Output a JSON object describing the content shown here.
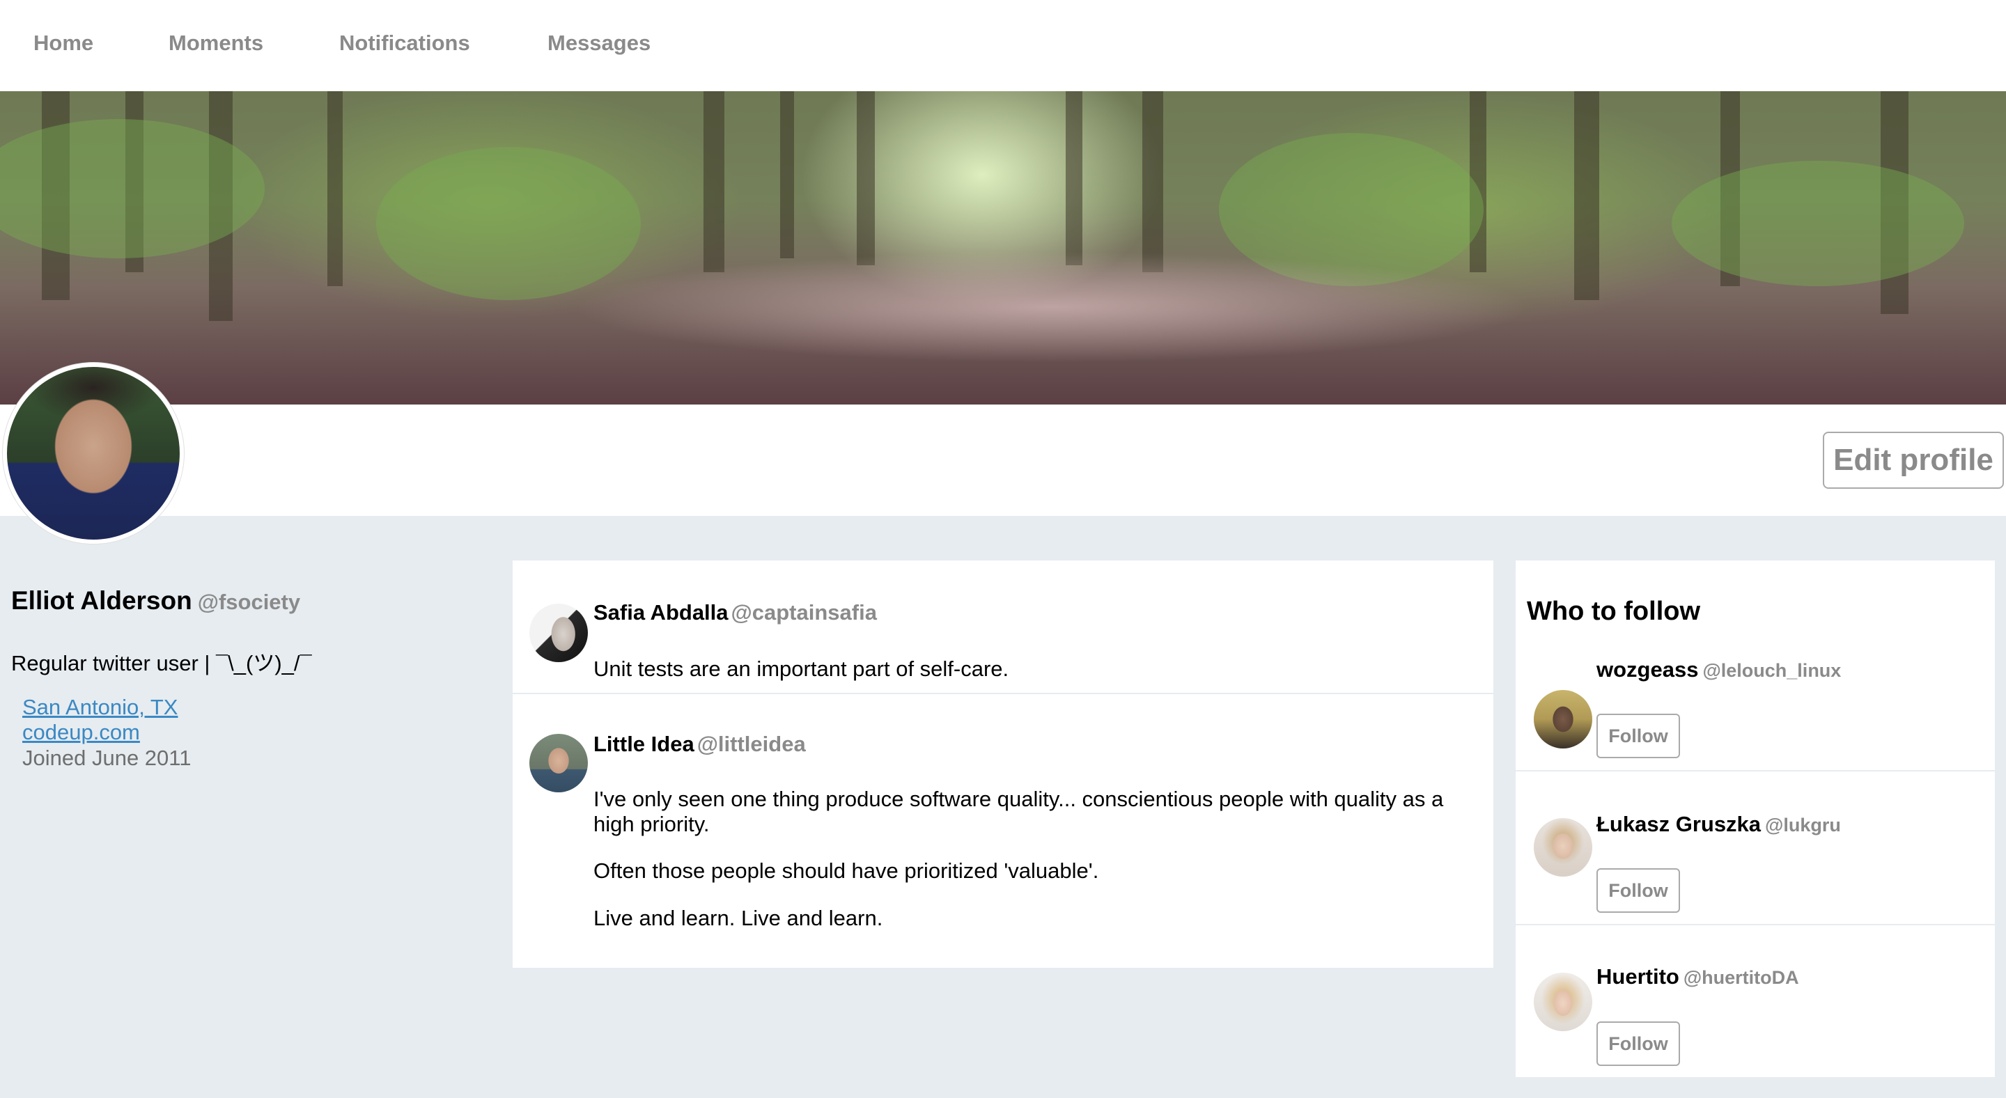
{
  "nav": {
    "items": [
      {
        "label": "Home"
      },
      {
        "label": "Moments"
      },
      {
        "label": "Notifications"
      },
      {
        "label": "Messages"
      }
    ]
  },
  "profile": {
    "name": "Elliot Alderson",
    "handle": "@fsociety",
    "bio": "Regular twitter user | ¯\\_(ツ)_/¯",
    "location": "San Antonio, TX",
    "website": "codeup.com",
    "joined": "Joined June 2011",
    "edit_label": "Edit profile"
  },
  "tweets": [
    {
      "name": "Safia Abdalla",
      "handle": "@captainsafia",
      "paragraphs": [
        "Unit tests are an important part of self-care."
      ]
    },
    {
      "name": "Little Idea",
      "handle": "@littleidea",
      "paragraphs": [
        "I've only seen one thing produce software quality... conscientious people with quality as a high priority.",
        "Often those people should have prioritized 'valuable'.",
        "Live and learn. Live and learn."
      ]
    }
  ],
  "who_to_follow": {
    "title": "Who to follow",
    "follow_label": "Follow",
    "users": [
      {
        "name": "wozgeass",
        "handle": "@lelouch_linux"
      },
      {
        "name": "Łukasz Gruszka",
        "handle": "@lukgru"
      },
      {
        "name": "Huertito",
        "handle": "@huertitoDA"
      }
    ]
  },
  "colors": {
    "page_bg": "#e6ecf0",
    "muted_text": "#8a8a8a",
    "link": "#3b88c3"
  }
}
